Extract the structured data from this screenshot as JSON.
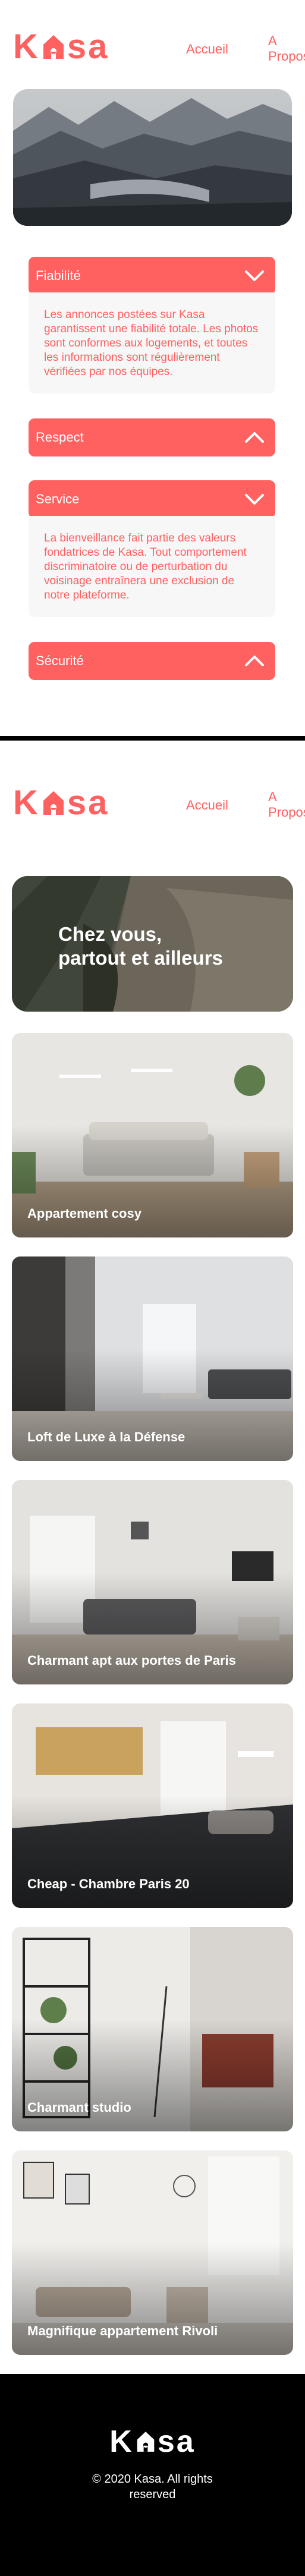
{
  "brand": {
    "name_left": "K",
    "name_right": "sa",
    "footer_left": "K",
    "footer_right": "sa"
  },
  "colors": {
    "accent": "#FF6060",
    "panel": "#F7F7F7",
    "footer": "#000000"
  },
  "nav": {
    "home": "Accueil",
    "about": "A Propos"
  },
  "about": {
    "collapses": [
      {
        "title": "Fiabilité",
        "expanded": true,
        "icon": "chevron-down-icon",
        "body": "Les annonces postées sur Kasa garantissent une fiabilité totale. Les photos sont conformes aux logements, et toutes les informations sont régulièrement vérifiées par nos équipes."
      },
      {
        "title": "Respect",
        "expanded": false,
        "icon": "chevron-up-icon",
        "body": ""
      },
      {
        "title": "Service",
        "expanded": true,
        "icon": "chevron-down-icon",
        "body": "La bienveillance fait partie des valeurs fondatrices de Kasa. Tout comportement discriminatoire ou de perturbation du voisinage entraînera une exclusion de notre plateforme."
      },
      {
        "title": "Sécurité",
        "expanded": false,
        "icon": "chevron-up-icon",
        "body": ""
      }
    ]
  },
  "home": {
    "hero_line1": "Chez vous,",
    "hero_line2": "partout et ailleurs",
    "listings": [
      {
        "title": "Appartement cosy"
      },
      {
        "title": "Loft de Luxe à la Défense"
      },
      {
        "title": "Charmant apt aux portes de Paris"
      },
      {
        "title": "Cheap - Chambre Paris 20"
      },
      {
        "title": "Charmant studio"
      },
      {
        "title": "Magnifique appartement Rivoli"
      }
    ]
  },
  "footer": {
    "copyright_line1": "© 2020 Kasa. All rights",
    "copyright_line2": "reserved"
  }
}
